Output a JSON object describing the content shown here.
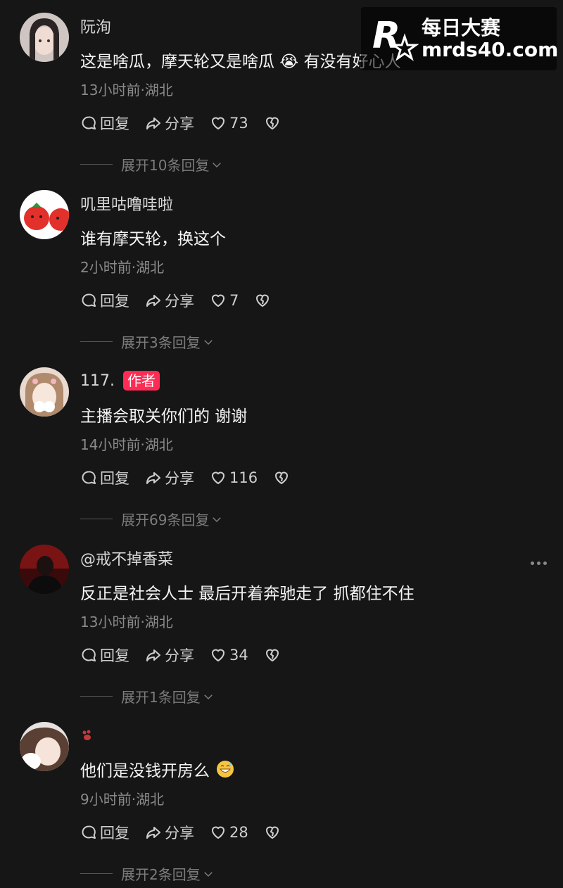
{
  "watermark": {
    "title": "每日大赛",
    "url": "mrds40.com"
  },
  "comments": [
    {
      "username": "阮洵",
      "text": "这是啥瓜，摩天轮又是啥瓜 😭 有没有好心人",
      "time": "13小时前",
      "location": "湖北",
      "meta": "13小时前·湖北",
      "reply_label": "回复",
      "share_label": "分享",
      "likes": "73",
      "expand_label": "展开10条回复"
    },
    {
      "username": "叽里咕噜哇啦",
      "text": "谁有摩天轮，换这个",
      "time": "2小时前",
      "location": "湖北",
      "meta": "2小时前·湖北",
      "reply_label": "回复",
      "share_label": "分享",
      "likes": "7",
      "expand_label": "展开3条回复"
    },
    {
      "username": "117.",
      "badge": "作者",
      "text": "主播会取关你们的 谢谢",
      "time": "14小时前",
      "location": "湖北",
      "meta": "14小时前·湖北",
      "reply_label": "回复",
      "share_label": "分享",
      "likes": "116",
      "expand_label": "展开69条回复"
    },
    {
      "username": "@戒不掉香菜",
      "text": "反正是社会人士 最后开着奔驰走了 抓都住不住",
      "time": "13小时前",
      "location": "湖北",
      "meta": "13小时前·湖北",
      "reply_label": "回复",
      "share_label": "分享",
      "likes": "34",
      "expand_label": "展开1条回复"
    },
    {
      "username": "",
      "text": "他们是没钱开房么",
      "time": "9小时前",
      "location": "湖北",
      "meta": "9小时前·湖北",
      "reply_label": "回复",
      "share_label": "分享",
      "likes": "28",
      "expand_label": "展开2条回复"
    }
  ],
  "icons": {
    "reply": "comment-bubble-icon",
    "share": "share-arrow-icon",
    "like": "heart-icon",
    "dislike": "broken-heart-icon",
    "expand": "chevron-down-icon",
    "more": "more-dots-icon"
  },
  "colors": {
    "background": "#161616",
    "badge": "#fe2c55",
    "meta": "#8a8a8a"
  }
}
